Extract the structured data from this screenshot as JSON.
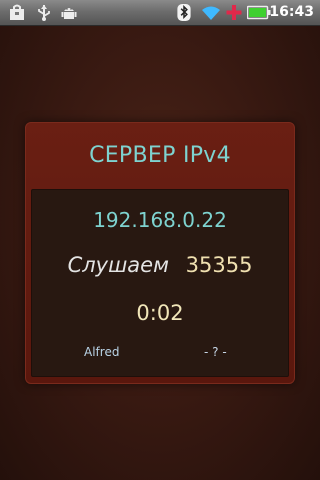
{
  "status_bar": {
    "time": "16:43",
    "icons": [
      "bag-icon",
      "usb-icon",
      "android-icon",
      "bluetooth-icon",
      "wifi-icon",
      "plus-icon",
      "battery-icon"
    ],
    "colors": {
      "wifi": "#3fb9ff",
      "plus": "#e0284a",
      "battery": "#3fd030"
    }
  },
  "server": {
    "title": "СЕРВЕР IPv4",
    "ip": "192.168.0.22",
    "listening_label": "Слушаем",
    "port": "35355",
    "elapsed": "0:02",
    "user": "Alfred",
    "peer": "- ? -"
  }
}
